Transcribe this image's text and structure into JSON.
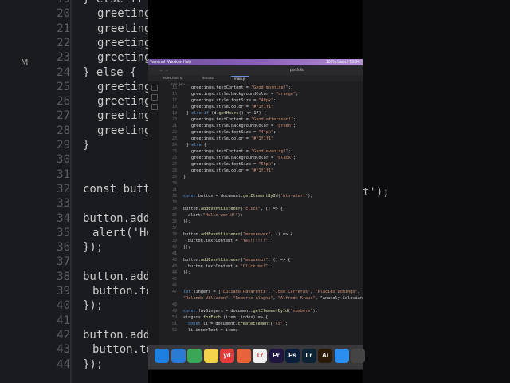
{
  "menubar": {
    "items": [
      "Terminal",
      "Window",
      "Help"
    ],
    "status": "100% Ladn / 19:34"
  },
  "titlebar": {
    "title": "portfolio"
  },
  "tabs": [
    "index.html M",
    "intro.txt",
    "main.js"
  ],
  "breadcrumb": "main.js > ...",
  "editor_lines": [
    {
      "n": "15",
      "c": "greetings.textContent = \"Good morning!\";"
    },
    {
      "n": "16",
      "c": "greetings.style.backgroundColor = \"orange\";"
    },
    {
      "n": "17",
      "c": "greetings.style.fontSize = \"48px\";"
    },
    {
      "n": "18",
      "c": "greetings.style.color = \"#f1f1f1\""
    },
    {
      "n": "19",
      "c": "} else if (d.getHours() <= 17) {"
    },
    {
      "n": "20",
      "c": "greetings.textContent = \"Good afternoon!\";"
    },
    {
      "n": "21",
      "c": "greetings.style.backgroundColor = \"green\";"
    },
    {
      "n": "22",
      "c": "greetings.style.fontSize = \"44px\";"
    },
    {
      "n": "23",
      "c": "greetings.style.color = \"#f1f1f1\""
    },
    {
      "n": "24",
      "c": "} else {"
    },
    {
      "n": "25",
      "c": "greetings.textContent = \"Good evening!\";"
    },
    {
      "n": "26",
      "c": "greetings.style.backgroundColor = \"black\";"
    },
    {
      "n": "27",
      "c": "greetings.style.fontSize = \"56px\";"
    },
    {
      "n": "28",
      "c": "greetings.style.color = \"#f1f1f1\""
    },
    {
      "n": "29",
      "c": "}"
    },
    {
      "n": "30",
      "c": ""
    },
    {
      "n": "31",
      "c": ""
    },
    {
      "n": "32",
      "c": "const button = document.getElementById('btn-alert');"
    },
    {
      "n": "33",
      "c": ""
    },
    {
      "n": "34",
      "c": "button.addEventListener(\"click\", () => {"
    },
    {
      "n": "35",
      "c": "alert(\"Hello world!\");"
    },
    {
      "n": "36",
      "c": "});"
    },
    {
      "n": "37",
      "c": ""
    },
    {
      "n": "38",
      "c": "button.addEventListener(\"mouseover\", () => {"
    },
    {
      "n": "39",
      "c": "button.textContent = \"Yes!!!!!!\";"
    },
    {
      "n": "40",
      "c": "});"
    },
    {
      "n": "41",
      "c": ""
    },
    {
      "n": "42",
      "c": "button.addEventListener(\"mouseout\", () => {"
    },
    {
      "n": "43",
      "c": "button.textContent = \"Click me!\";"
    },
    {
      "n": "44",
      "c": "});"
    },
    {
      "n": "45",
      "c": ""
    },
    {
      "n": "46",
      "c": ""
    },
    {
      "n": "47",
      "c": "let singers = [\"Luciano Pavarotti\", \"José Carreras\", \"Plácido Domingo\", \""
    },
    {
      "n": "",
      "c": "\"Rolando Villazón\", \"Roberto Alagna\", \"Alfredo Kraus\", \"Anatoly Solovian"
    },
    {
      "n": "48",
      "c": ""
    },
    {
      "n": "49",
      "c": "const favSingers = document.getElementById(\"numbers\");"
    },
    {
      "n": "50",
      "c": "singers.forEach((item, index) => {"
    },
    {
      "n": "51",
      "c": "const li = document.createElement(\"li\");"
    },
    {
      "n": "52",
      "c": "li.innerText = item;"
    }
  ],
  "background_left": {
    "line_numbers": [
      "19",
      "20",
      "21",
      "22",
      "23",
      "24",
      "25",
      "26",
      "27",
      "28",
      "29",
      "30",
      "31",
      "32",
      "33",
      "34",
      "35",
      "36",
      "37",
      "38",
      "39",
      "40",
      "41",
      "42",
      "43",
      "44"
    ],
    "code": [
      "} else if",
      "greetings",
      "greetings",
      "greetings",
      "greetings",
      "} else {",
      "greetings",
      "greetings",
      "greetings",
      "greetings",
      "}",
      "",
      "",
      "const butto",
      "",
      "button.addE",
      "alert('He",
      "});",
      "",
      "button.addE",
      "button.tex",
      "});",
      "",
      "button.addEv",
      "button.tex",
      "});"
    ],
    "marker": "M"
  },
  "background_right": {
    "text": "t');"
  },
  "dock_apps": [
    {
      "name": "safari",
      "label": "",
      "color": "#1e7fe0"
    },
    {
      "name": "vscode",
      "label": "",
      "color": "#2a7bd4"
    },
    {
      "name": "chrome",
      "label": "",
      "color": "#3aa757"
    },
    {
      "name": "notes",
      "label": "",
      "color": "#f4d24b"
    },
    {
      "name": "yd",
      "label": "yd",
      "color": "#e23b3b"
    },
    {
      "name": "figma",
      "label": "",
      "color": "#e8623a"
    },
    {
      "name": "calendar",
      "label": "17",
      "color": "#f2f2f2"
    },
    {
      "name": "premiere",
      "label": "Pr",
      "color": "#1f1540"
    },
    {
      "name": "photoshop",
      "label": "Ps",
      "color": "#0a1f3c"
    },
    {
      "name": "lightroom",
      "label": "Lr",
      "color": "#0b2333"
    },
    {
      "name": "illustrator",
      "label": "Ai",
      "color": "#2b1a05"
    },
    {
      "name": "appstore",
      "label": "",
      "color": "#2a8ef0"
    },
    {
      "name": "other",
      "label": "",
      "color": "#444"
    }
  ]
}
